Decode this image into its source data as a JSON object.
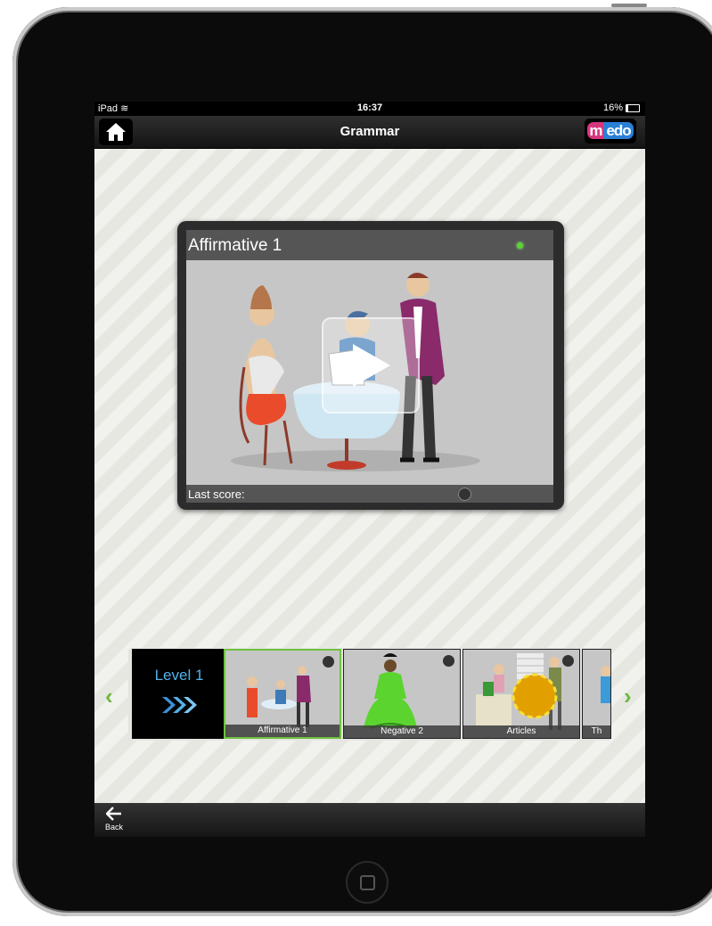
{
  "status": {
    "carrier": "iPad",
    "time": "16:37",
    "battery": "16%"
  },
  "nav": {
    "title": "Grammar",
    "logo_m": "m",
    "logo_rest": "edo"
  },
  "lesson": {
    "title": "Affirmative 1",
    "score_label": "Last score:"
  },
  "level": {
    "label": "Level 1"
  },
  "thumbnails": [
    {
      "label": "Affirmative 1",
      "selected": true
    },
    {
      "label": "Negative 2",
      "selected": false
    },
    {
      "label": "Articles",
      "selected": false
    },
    {
      "label": "Th",
      "selected": false
    }
  ],
  "toolbar": {
    "back_label": "Back"
  },
  "colors": {
    "accent_green": "#6fc23f",
    "level_blue": "#53b1ea",
    "logo_pink": "#d8357e",
    "logo_blue": "#2a80d6"
  }
}
